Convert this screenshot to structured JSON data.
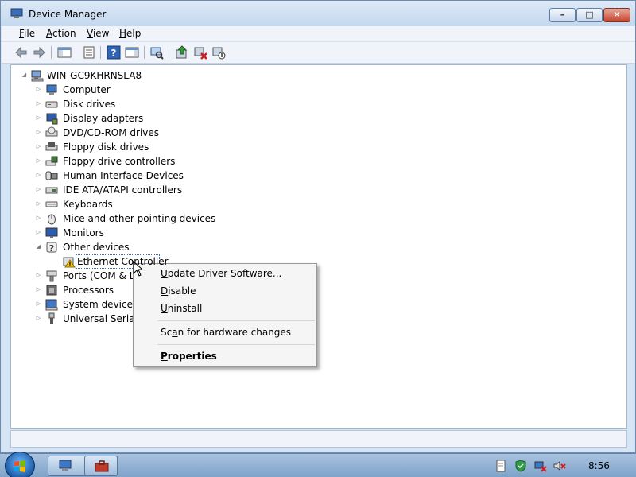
{
  "window": {
    "title": "Device Manager",
    "controls": {
      "minimize": "–",
      "maximize": "□",
      "close": "✕"
    }
  },
  "menu": [
    {
      "label": "File",
      "accel": "F",
      "rest": "ile"
    },
    {
      "label": "Action",
      "accel": "A",
      "rest": "ction"
    },
    {
      "label": "View",
      "accel": "V",
      "rest": "iew"
    },
    {
      "label": "Help",
      "accel": "H",
      "rest": "elp"
    }
  ],
  "toolbar": {
    "icons": [
      "back-arrow-icon",
      "forward-arrow-icon",
      "show-hide-console-tree-icon",
      "properties-icon",
      "help-icon",
      "action-pane-icon",
      "scan-hardware-icon",
      "update-driver-icon",
      "uninstall-device-icon",
      "disable-device-icon"
    ]
  },
  "tree": {
    "root": "WIN-GC9KHRNSLA8",
    "items": [
      "Computer",
      "Disk drives",
      "Display adapters",
      "DVD/CD-ROM drives",
      "Floppy disk drives",
      "Floppy drive controllers",
      "Human Interface Devices",
      "IDE ATA/ATAPI controllers",
      "Keyboards",
      "Mice and other pointing devices",
      "Monitors",
      "Other devices",
      "Ethernet Controller",
      "Ports (COM & LP",
      "Processors",
      "System devices",
      "Universal Serial B"
    ]
  },
  "context_menu": {
    "update": {
      "accel": "U",
      "rest": "pdate Driver Software..."
    },
    "disable": {
      "accel": "D",
      "rest": "isable"
    },
    "uninstall": {
      "accel": "U",
      "rest": "ninstall"
    },
    "scan": {
      "pre": "Sc",
      "accel": "a",
      "rest": "n for hardware changes"
    },
    "properties": {
      "accel": "P",
      "rest": "roperties"
    }
  },
  "taskbar": {
    "clock": "8:56"
  },
  "colors": {
    "title_bg": "#c4d8ee",
    "warning_yellow": "#f2c300",
    "selection_border": "#3d6fb0"
  }
}
